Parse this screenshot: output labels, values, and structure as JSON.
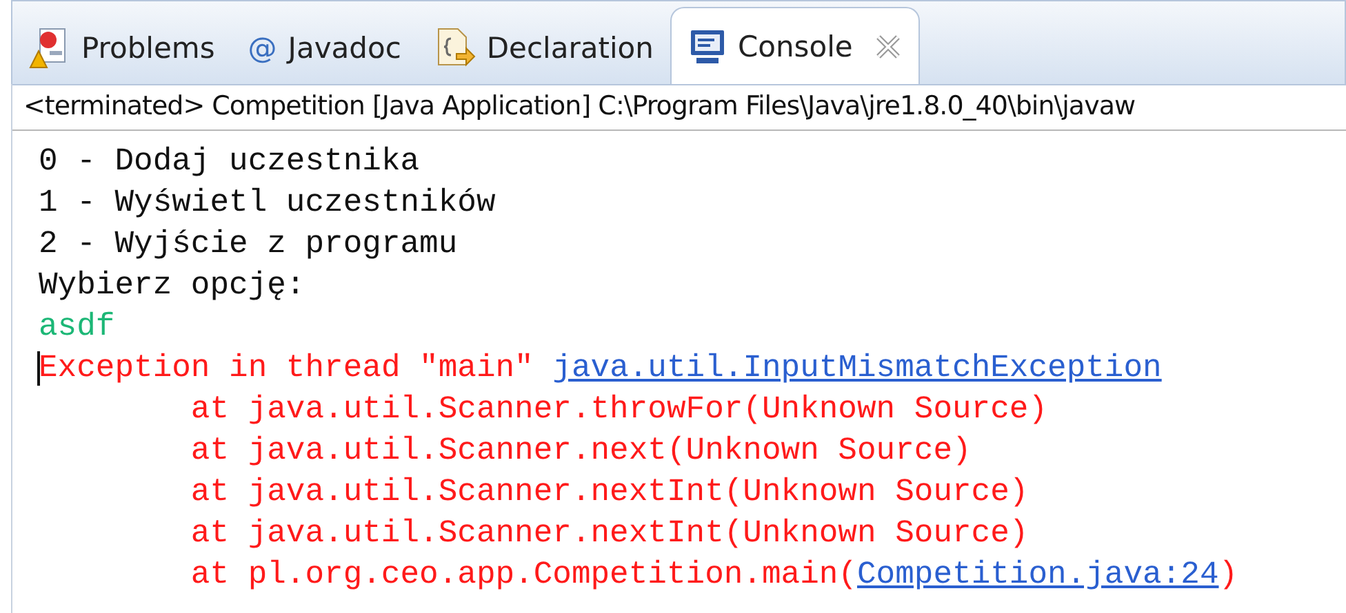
{
  "tabs": [
    {
      "label": "Problems",
      "selected": false,
      "closable": false
    },
    {
      "label": "Javadoc",
      "glyph": "@",
      "selected": false,
      "closable": false
    },
    {
      "label": "Declaration",
      "selected": false,
      "closable": false
    },
    {
      "label": "Console",
      "selected": true,
      "closable": true
    }
  ],
  "console": {
    "header": "<terminated> Competition [Java Application] C:\\Program Files\\Java\\jre1.8.0_40\\bin\\javaw",
    "lines": [
      {
        "kind": "output",
        "segments": [
          {
            "text": "0 - Dodaj uczestnika",
            "link": false
          }
        ]
      },
      {
        "kind": "output",
        "segments": [
          {
            "text": "1 - Wyświetl uczestników",
            "link": false
          }
        ]
      },
      {
        "kind": "output",
        "segments": [
          {
            "text": "2 - Wyjście z programu",
            "link": false
          }
        ]
      },
      {
        "kind": "output",
        "segments": [
          {
            "text": "Wybierz opcję:",
            "link": false
          }
        ]
      },
      {
        "kind": "input",
        "segments": [
          {
            "text": "asdf",
            "link": false
          }
        ]
      },
      {
        "kind": "error",
        "cursor": true,
        "segments": [
          {
            "text": "Exception in thread \"main\" ",
            "link": false
          },
          {
            "text": "java.util.InputMismatchException",
            "link": true
          }
        ]
      },
      {
        "kind": "stack",
        "segments": [
          {
            "text": "at java.util.Scanner.throwFor(Unknown Source)",
            "link": false
          }
        ]
      },
      {
        "kind": "stack",
        "segments": [
          {
            "text": "at java.util.Scanner.next(Unknown Source)",
            "link": false
          }
        ]
      },
      {
        "kind": "stack",
        "segments": [
          {
            "text": "at java.util.Scanner.nextInt(Unknown Source)",
            "link": false
          }
        ]
      },
      {
        "kind": "stack",
        "segments": [
          {
            "text": "at java.util.Scanner.nextInt(Unknown Source)",
            "link": false
          }
        ]
      },
      {
        "kind": "stack",
        "segments": [
          {
            "text": "at pl.org.ceo.app.Competition.main(",
            "link": false
          },
          {
            "text": "Competition.java:24",
            "link": true
          },
          {
            "text": ")",
            "link": false
          }
        ]
      }
    ]
  }
}
